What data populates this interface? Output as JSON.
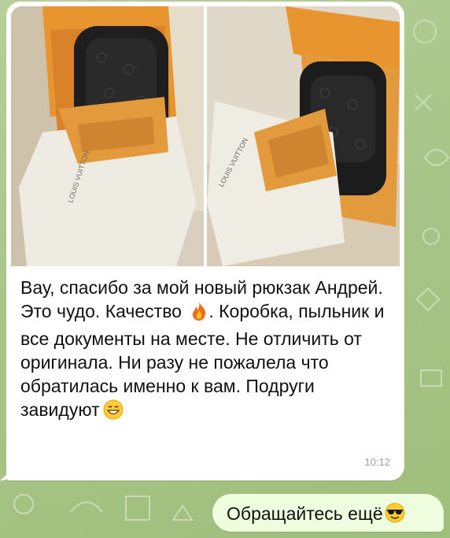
{
  "chat": {
    "incoming": {
      "photos": [
        {
          "brand_print": "LOUIS VUITTON"
        },
        {
          "brand_print": "LOUIS VUITTON"
        }
      ],
      "text_parts": [
        "Вау, спасибо за мой новый рюкзак Андрей. Это чудо. Качество ",
        ". Коробка, пыльник и все документы на месте. Не отличить от оригинала. Ни разу не пожалела что обратилась именно к вам. Подруги завидуют"
      ],
      "emojis": [
        "fire-emoji",
        "smiling-face-emoji"
      ],
      "time": "10:12"
    },
    "outgoing": {
      "text": "Обращайтесь ещё",
      "emoji": "sunglasses-face-emoji"
    }
  },
  "colors": {
    "wallpaper": "#a9c68a",
    "incoming_bubble": "#ffffff",
    "outgoing_bubble": "#eefedf",
    "box_orange": "#e7932e"
  }
}
